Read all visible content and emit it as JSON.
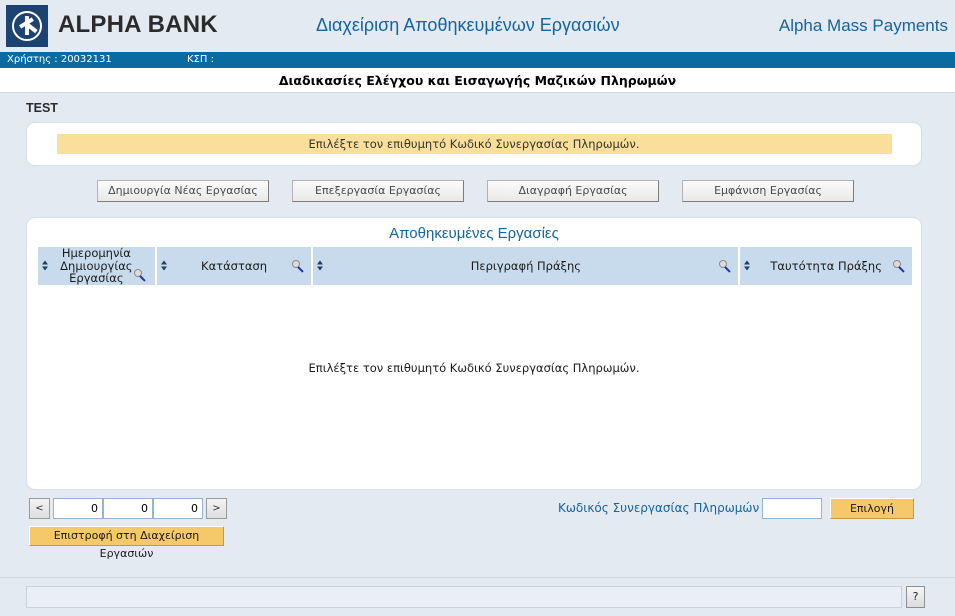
{
  "header": {
    "logo_name": "alpha-bank-logo",
    "brand": "ALPHA BANK",
    "app_title": "Διαχείριση Αποθηκευμένων Εργασιών",
    "app_right": "Alpha Mass Payments",
    "accent_blue": "#1464a0",
    "logo_navy": "#1d4372"
  },
  "userbar": {
    "user_label": "Χρήστης :  20032131",
    "kep_label": "ΚΣΠ :",
    "bg": "#0a6ba3"
  },
  "subtitle": "Διαδικασίες Ελέγχου και Εισαγωγής Μαζικών Πληρωμών",
  "environment_label": "TEST",
  "message": {
    "text": "Επιλέξτε τον επιθυμητό Κωδικό Συνεργασίας Πληρωμών.",
    "bg": "#fadf9a"
  },
  "toolbar": {
    "create_label": "Δημιουργία Νέας Εργασίας",
    "edit_label": "Επεξεργασία Εργασίας",
    "delete_label": "Διαγραφή Εργασίας",
    "view_label": "Εμφάνιση Εργασίας"
  },
  "table": {
    "title": "Αποθηκευμένες Εργασίες",
    "header_bg": "#c7dbec",
    "columns": [
      {
        "label": "Ημερομηνία Δημιουργίας Εργασίας",
        "sort_icon": "sort-updown-icon",
        "filter_icon": "magnifier-icon"
      },
      {
        "label": "Κατάσταση",
        "sort_icon": "sort-updown-icon",
        "filter_icon": "magnifier-icon"
      },
      {
        "label": "Περιγραφή Πράξης",
        "sort_icon": "sort-updown-icon",
        "filter_icon": "magnifier-icon"
      },
      {
        "label": "Ταυτότητα Πράξης",
        "sort_icon": "sort-updown-icon",
        "filter_icon": "magnifier-icon"
      }
    ],
    "rows": [],
    "empty_message": "Επιλέξτε τον επιθυμητό Κωδικό Συνεργασίας Πληρωμών."
  },
  "pagination": {
    "prev_label": "<",
    "next_label": ">",
    "value_0": "0",
    "value_1": "0",
    "value_2": "0"
  },
  "actions": {
    "back_label": "Επιστροφή στη Διαχείριση Εργασιών",
    "code_label": "Κωδικός Συνεργασίας Πληρωμών :",
    "code_value": "",
    "select_label": "Επιλογή",
    "amber": "#f5c96a"
  },
  "statusbar": {
    "message": "",
    "help_label": "?"
  }
}
